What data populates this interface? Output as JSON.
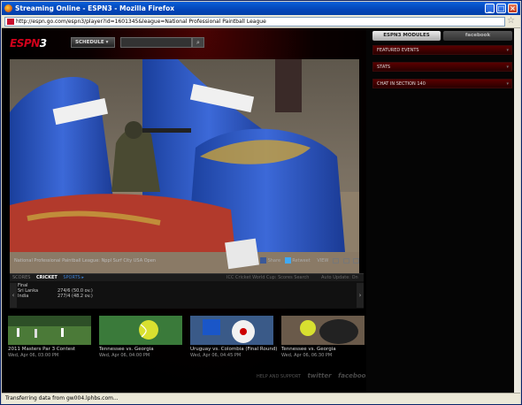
{
  "window": {
    "title": "Streaming Online - ESPN3 - Mozilla Firefox",
    "minimize": "_",
    "maximize": "□",
    "close": "×"
  },
  "address": {
    "url": "http://espn.go.com/espn3/player?id=1601345&league=National Professional Paintball League"
  },
  "header": {
    "logo_espn": "ESPN",
    "logo_3": "3",
    "schedule_label": "SCHEDULE ▾",
    "search_placeholder": "",
    "search_icon": "search-icon",
    "search_glyph": "⌕"
  },
  "video": {
    "caption": "National Professional Paintball League: Nppl Surf City USA Open",
    "share_label": "Share",
    "retweet_label": "Retweet",
    "view_label": "VIEW"
  },
  "scores": {
    "label": "SCORES",
    "tab_cricket": "CRICKET",
    "tab_sports": "SPORTS ▸",
    "right_text": "ICC Cricket World Cup: Scores Search",
    "right_text2": "Auto Update: On",
    "status": "Final",
    "team1": "Sri Lanka",
    "team1_score": "274/6 (50.0 ov.)",
    "team2": "India",
    "team2_score": "277/4 (48.2 ov.)",
    "prev": "‹",
    "next": "›"
  },
  "thumbs": [
    {
      "title": "2011 Masters Par 3 Contest",
      "time": "Wed, Apr 06, 03:00 PM"
    },
    {
      "title": "Tennessee vs. Georgia",
      "time": "Wed, Apr 06, 04:00 PM"
    },
    {
      "title": "Uruguay vs. Colombia (Final Round)",
      "time": "Wed, Apr 06, 04:45 PM"
    },
    {
      "title": "Tennessee vs. Georgia",
      "time": "Wed, Apr 06, 06:30 PM"
    }
  ],
  "footer": {
    "help": "HELP AND SUPPORT",
    "twitter": "twitter",
    "facebook": "facebook"
  },
  "sidebar": {
    "tab_modules": "ESPN3 MODULES",
    "tab_facebook": "facebook",
    "featured": "FEATURED EVENTS",
    "stats": "STATS",
    "chat": "CHAT IN SECTION 140"
  },
  "status": {
    "text": "Transferring data from gw004.lphbs.com..."
  }
}
